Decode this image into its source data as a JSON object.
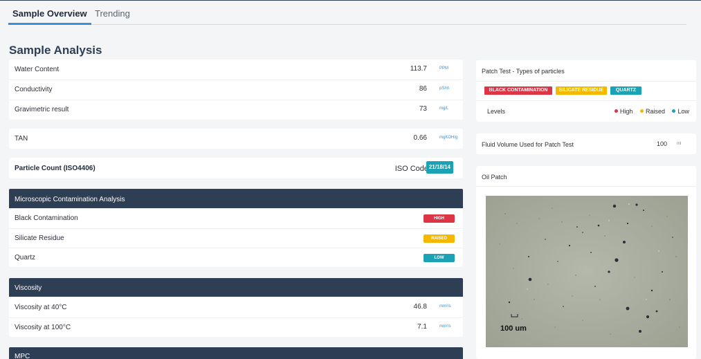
{
  "tabs": [
    {
      "label": "Sample Overview",
      "active": true
    },
    {
      "label": "Trending",
      "active": false
    }
  ],
  "page_title": "Sample Analysis",
  "measurements": [
    {
      "label": "Water Content",
      "value": "113.7",
      "unit": "PPM"
    },
    {
      "label": "Conductivity",
      "value": "86",
      "unit": "pS/m"
    },
    {
      "label": "Gravimetric result",
      "value": "73",
      "unit": "mg/L"
    }
  ],
  "tan": {
    "label": "TAN",
    "value": "0.66",
    "unit": "mgKOH/g"
  },
  "particle_count": {
    "label": "Particle Count (ISO4406)",
    "iso_label": "ISO Code",
    "iso_value": "21/18/14"
  },
  "microscopic": {
    "title": "Microscopic Contamination Analysis",
    "rows": [
      {
        "label": "Black Contamination",
        "level": "HIGH"
      },
      {
        "label": "Silicate Residue",
        "level": "RAISED"
      },
      {
        "label": "Quartz",
        "level": "LOW"
      }
    ]
  },
  "viscosity": {
    "title": "Viscosity",
    "rows": [
      {
        "label": "Viscosity at 40°C",
        "value": "46.8",
        "unit": "mm²/s"
      },
      {
        "label": "Viscosity at 100°C",
        "value": "7.1",
        "unit": "mm²/s"
      }
    ]
  },
  "mpc": {
    "title": "MPC"
  },
  "patch_test": {
    "title": "Patch Test - Types of particles",
    "tags": [
      "BLACK CONTAMINATION",
      "SILICATE RESIDUE",
      "QUARTZ"
    ],
    "levels_label": "Levels",
    "legend": [
      {
        "label": "High",
        "color": "#dc3545"
      },
      {
        "label": "Raised",
        "color": "#f5b800"
      },
      {
        "label": "Low",
        "color": "#1ba2b4"
      }
    ]
  },
  "fluid_volume": {
    "label": "Fluid Volume Used for Patch Test",
    "value": "100",
    "unit": "ml"
  },
  "oil_patch": {
    "title": "Oil Patch",
    "scale_label": "100 um"
  },
  "colors": {
    "high": "#dc3545",
    "raised": "#f5b800",
    "low": "#1ba2b4",
    "header": "#2d3e55",
    "accent": "#3b8fd9"
  }
}
